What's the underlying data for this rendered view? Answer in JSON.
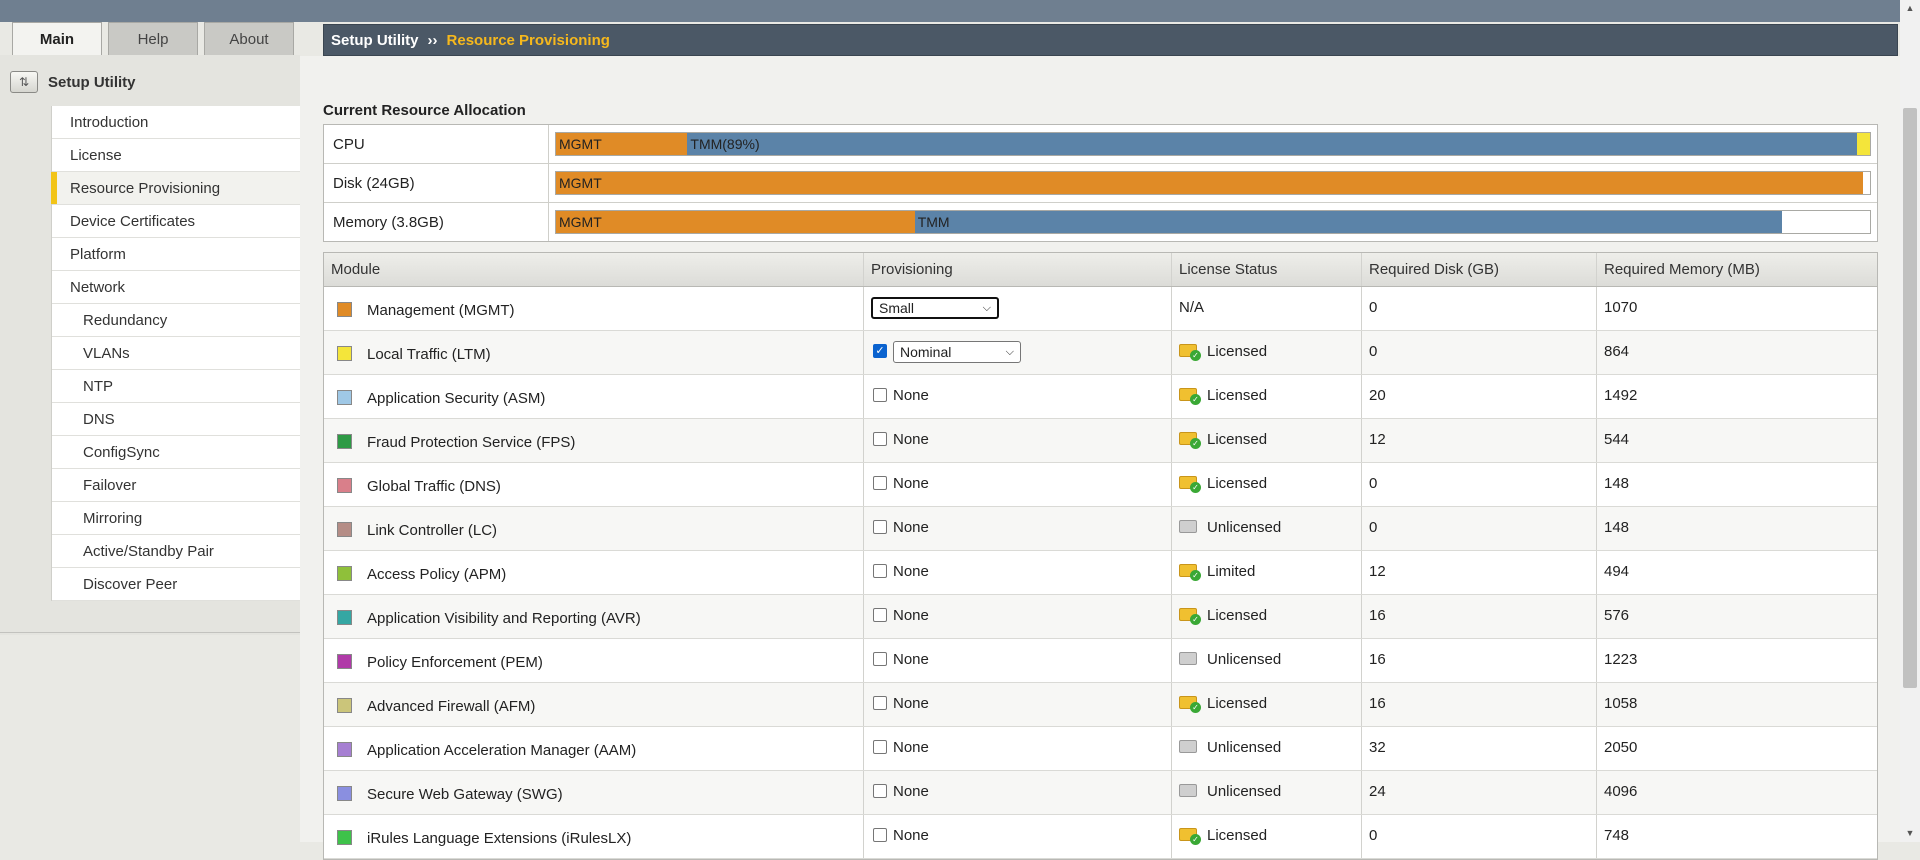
{
  "tabs": [
    {
      "label": "Main"
    },
    {
      "label": "Help"
    },
    {
      "label": "About"
    }
  ],
  "sidebar": {
    "title": "Setup Utility",
    "items": [
      {
        "label": "Introduction"
      },
      {
        "label": "License"
      },
      {
        "label": "Resource Provisioning"
      },
      {
        "label": "Device Certificates"
      },
      {
        "label": "Platform"
      },
      {
        "label": "Network"
      },
      {
        "label": "Redundancy"
      },
      {
        "label": "VLANs"
      },
      {
        "label": "NTP"
      },
      {
        "label": "DNS"
      },
      {
        "label": "ConfigSync"
      },
      {
        "label": "Failover"
      },
      {
        "label": "Mirroring"
      },
      {
        "label": "Active/Standby Pair"
      },
      {
        "label": "Discover Peer"
      }
    ]
  },
  "breadcrumb": {
    "root": "Setup Utility",
    "separator": "››",
    "current": "Resource Provisioning"
  },
  "allocation": {
    "title": "Current Resource Allocation",
    "colors": {
      "mgmt": "#e08b26",
      "tmm": "#5b83a8",
      "ltm": "#f4e53a"
    },
    "rows": [
      {
        "label": "CPU",
        "mgmt_label": "MGMT",
        "tmm_label": "TMM(89%)",
        "mgmt_fraction": 0.1,
        "tmm_fraction": 0.89,
        "ltm_fraction": 0.01
      },
      {
        "label": "Disk (24GB)",
        "mgmt_label": "MGMT",
        "tmm_label": "",
        "mgmt_fraction": 0.995,
        "tmm_fraction": 0,
        "ltm_fraction": 0
      },
      {
        "label": "Memory (3.8GB)",
        "mgmt_label": "MGMT",
        "tmm_label": "TMM",
        "mgmt_fraction": 0.273,
        "tmm_fraction": 0.66,
        "ltm_fraction": 0
      }
    ]
  },
  "modules": {
    "headers": {
      "module": "Module",
      "provisioning": "Provisioning",
      "license": "License Status",
      "disk": "Required Disk (GB)",
      "memory": "Required Memory (MB)"
    },
    "rows": [
      {
        "name": "Management (MGMT)",
        "color": "#e08b26",
        "prov_type": "select",
        "checked": false,
        "provisioning": "Small",
        "license": "N/A",
        "license_icon": "none",
        "disk": "0",
        "memory": "1070"
      },
      {
        "name": "Local Traffic (LTM)",
        "color": "#f4e53a",
        "prov_type": "select",
        "checked": true,
        "provisioning": "Nominal",
        "license": "Licensed",
        "license_icon": "licensed-icon",
        "disk": "0",
        "memory": "864"
      },
      {
        "name": "Application Security (ASM)",
        "color": "#9fc8e6",
        "prov_type": "none",
        "checked": false,
        "provisioning": "None",
        "license": "Licensed",
        "license_icon": "licensed-icon",
        "disk": "20",
        "memory": "1492"
      },
      {
        "name": "Fraud Protection Service (FPS)",
        "color": "#2e9a45",
        "prov_type": "none",
        "checked": false,
        "provisioning": "None",
        "license": "Licensed",
        "license_icon": "licensed-icon",
        "disk": "12",
        "memory": "544"
      },
      {
        "name": "Global Traffic (DNS)",
        "color": "#d97f8a",
        "prov_type": "none",
        "checked": false,
        "provisioning": "None",
        "license": "Licensed",
        "license_icon": "licensed-icon",
        "disk": "0",
        "memory": "148"
      },
      {
        "name": "Link Controller (LC)",
        "color": "#b58d86",
        "prov_type": "none",
        "checked": false,
        "provisioning": "None",
        "license": "Unlicensed",
        "license_icon": "unlicensed-icon",
        "disk": "0",
        "memory": "148"
      },
      {
        "name": "Access Policy (APM)",
        "color": "#8fc03a",
        "prov_type": "none",
        "checked": false,
        "provisioning": "None",
        "license": "Limited",
        "license_icon": "licensed-icon",
        "disk": "12",
        "memory": "494"
      },
      {
        "name": "Application Visibility and Reporting (AVR)",
        "color": "#35a7a3",
        "prov_type": "none",
        "checked": false,
        "provisioning": "None",
        "license": "Licensed",
        "license_icon": "licensed-icon",
        "disk": "16",
        "memory": "576"
      },
      {
        "name": "Policy Enforcement (PEM)",
        "color": "#b03aa8",
        "prov_type": "none",
        "checked": false,
        "provisioning": "None",
        "license": "Unlicensed",
        "license_icon": "unlicensed-icon",
        "disk": "16",
        "memory": "1223"
      },
      {
        "name": "Advanced Firewall (AFM)",
        "color": "#cbc57a",
        "prov_type": "none",
        "checked": false,
        "provisioning": "None",
        "license": "Licensed",
        "license_icon": "licensed-icon",
        "disk": "16",
        "memory": "1058"
      },
      {
        "name": "Application Acceleration Manager (AAM)",
        "color": "#a67fd2",
        "prov_type": "none",
        "checked": false,
        "provisioning": "None",
        "license": "Unlicensed",
        "license_icon": "unlicensed-icon",
        "disk": "32",
        "memory": "2050"
      },
      {
        "name": "Secure Web Gateway (SWG)",
        "color": "#8a8fe0",
        "prov_type": "none",
        "checked": false,
        "provisioning": "None",
        "license": "Unlicensed",
        "license_icon": "unlicensed-icon",
        "disk": "24",
        "memory": "4096"
      },
      {
        "name": "iRules Language Extensions (iRulesLX)",
        "color": "#3ec24a",
        "prov_type": "none",
        "checked": false,
        "provisioning": "None",
        "license": "Licensed",
        "license_icon": "licensed-icon",
        "disk": "0",
        "memory": "748"
      }
    ]
  }
}
